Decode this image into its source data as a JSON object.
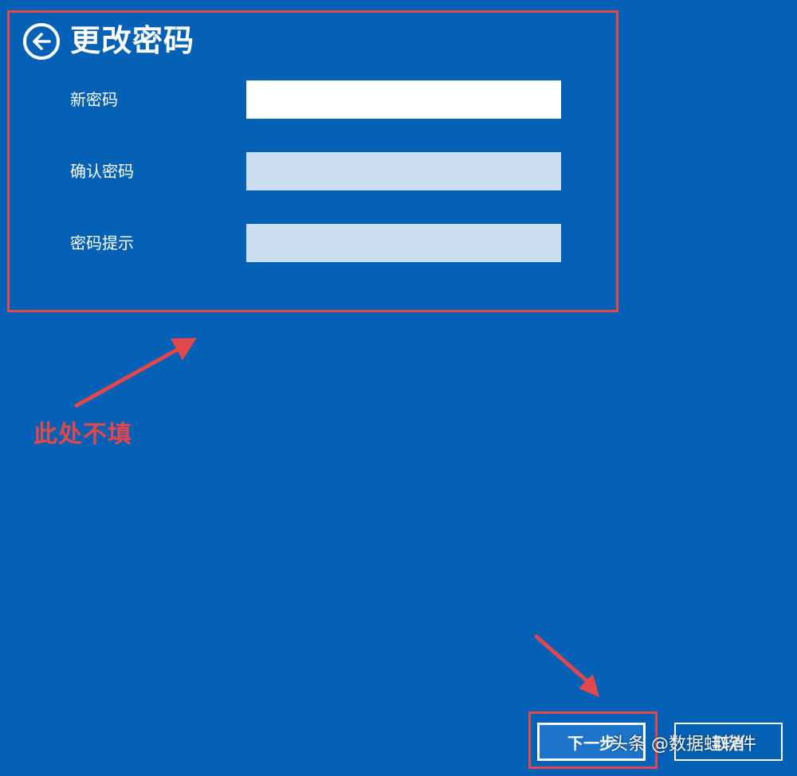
{
  "dialog": {
    "title": "更改密码",
    "back_icon": "arrow-left-circle-icon"
  },
  "fields": {
    "new_password": {
      "label": "新密码",
      "value": ""
    },
    "confirm_password": {
      "label": "确认密码",
      "value": ""
    },
    "password_hint": {
      "label": "密码提示",
      "value": ""
    }
  },
  "buttons": {
    "next_label": "下一步",
    "cancel_label": "取消"
  },
  "annotation": {
    "note": "此处不填",
    "color": "#E2474B"
  },
  "watermark": {
    "text": "头条 @数据蛙软件"
  },
  "colors": {
    "background": "#0461B5",
    "input_active": "#FFFFFF",
    "input_inactive": "#CCDFF0"
  }
}
